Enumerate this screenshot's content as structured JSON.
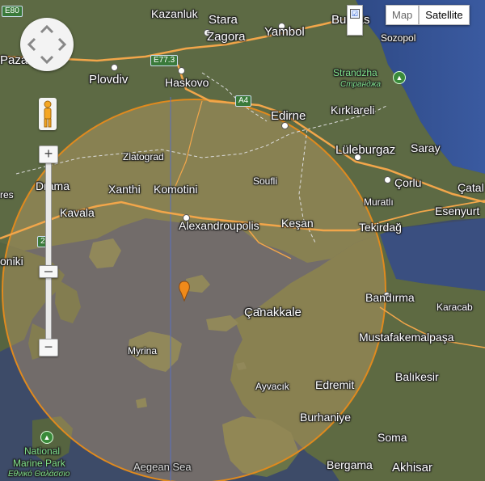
{
  "map_type": {
    "map_label": "Map",
    "satellite_label": "Satellite",
    "active": "Satellite"
  },
  "overlay_toggle": {
    "checked": true,
    "mark": "☑"
  },
  "controls": {
    "zoom_in": "+",
    "zoom_out": "−",
    "pan_icon": "pan-control-icon",
    "pegman_icon": "pegman-icon"
  },
  "colors": {
    "radius_circle": "#e08a1e",
    "marker": "#f08a1a",
    "road": "#f2a64a",
    "sea": "#3f4f6e",
    "land": "#5b6b45"
  },
  "roads": {
    "e80": "E80",
    "e773": "E77.3",
    "a4": "A4",
    "two": "2"
  },
  "places": {
    "kazanluk": "Kazanluk",
    "stara_zagora_1": "Stara",
    "stara_zagora_2": "Zagora",
    "yambol": "Yambol",
    "burgas": "Burgas",
    "sozopol": "Sozopol",
    "pazardzhik": "Paza",
    "plovdiv": "Plovdiv",
    "haskovo": "Haskovo",
    "strandzha": "Strandzha",
    "strandzha_local": "Странджа",
    "edirne": "Edirne",
    "kirklareli": "Kırklareli",
    "luleburgaz": "Lüleburgaz",
    "saray": "Saray",
    "zlatograd": "Zlatograd",
    "drama": "Drama",
    "xanthi": "Xanthi",
    "komotini": "Komotini",
    "soufli": "Soufli",
    "corlu": "Çorlu",
    "catalca": "Çatal",
    "muratli": "Muratlı",
    "esenyurt": "Esenyurt",
    "serres": "res",
    "kavala": "Kavala",
    "alexandroupolis": "Alexandroupolis",
    "kesan": "Keşan",
    "tekirdag": "Tekirdağ",
    "thessaloniki": "oniki",
    "bandirma": "Bandırma",
    "karacabey": "Karacab",
    "canakkale": "Çanakkale",
    "mustafakemalpasa": "Mustafakemalpaşa",
    "myrina": "Myrina",
    "balikesir": "Balıkesir",
    "ayvacik": "Ayvacık",
    "edremit": "Edremit",
    "burhaniye": "Burhaniye",
    "national_marine_park_1": "National",
    "national_marine_park_2": "Marine Park",
    "national_marine_park_greek": "Εθνικό Θαλάσσιο",
    "soma": "Soma",
    "aegean_sea": "Aegean Sea",
    "bergama": "Bergama",
    "akhisar": "Akhisar"
  }
}
